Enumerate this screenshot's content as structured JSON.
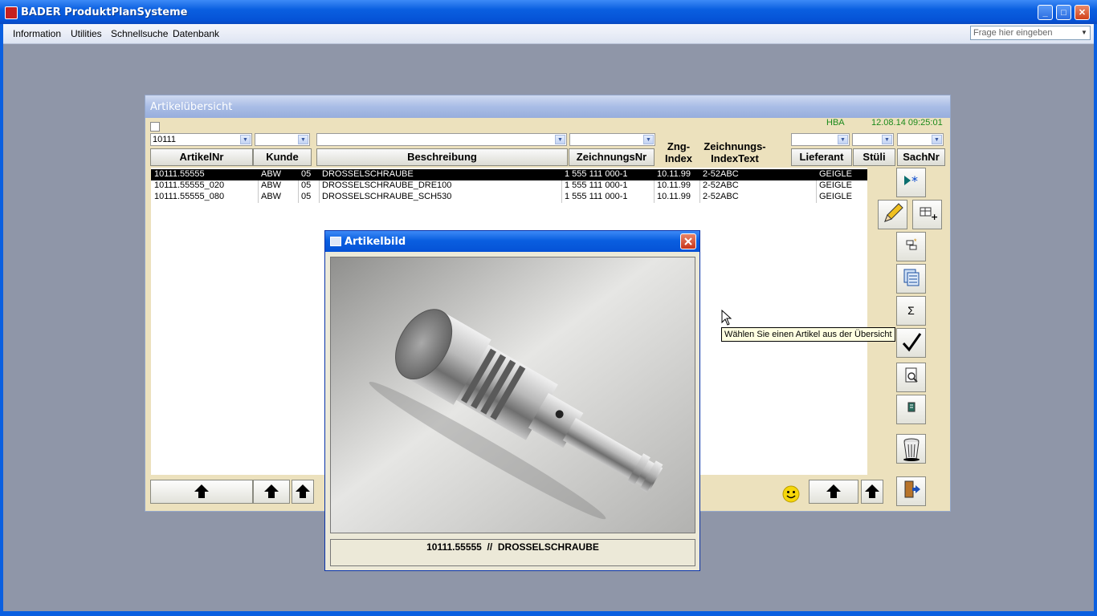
{
  "app": {
    "title": "BADER ProduktPlanSysteme"
  },
  "menu": {
    "items": [
      "Information",
      "Utilities",
      "Schnellsuche",
      "Datenbank"
    ],
    "ask_placeholder": "Frage hier eingeben"
  },
  "overview": {
    "title": "Artikelübersicht",
    "user": "HBA",
    "datetime": "12.08.14 09:25:01",
    "filter_artikel": "10111",
    "headers": {
      "artikelnr": "ArtikelNr",
      "kunde": "Kunde",
      "beschreibung": "Beschreibung",
      "zeichnungsnr": "ZeichnungsNr",
      "zng_index": "Zng-\nIndex",
      "zeichnungs_index_text": "Zeichnungs-\nIndexText",
      "lieferant": "Lieferant",
      "stueli": "Stüli",
      "sachnr": "SachNr"
    },
    "rows": [
      {
        "artikelnr": "10111.55555",
        "kunde": "ABW",
        "nr": "05",
        "beschreibung": "DROSSELSCHRAUBE",
        "zeichnungsnr": "1 555 111 000-1",
        "index": "10.11.99",
        "indextext": "2-52ABC",
        "lieferant": "GEIGLE"
      },
      {
        "artikelnr": "10111.55555_020",
        "kunde": "ABW",
        "nr": "05",
        "beschreibung": "DROSSELSCHRAUBE_DRE100",
        "zeichnungsnr": "1 555 111 000-1",
        "index": "10.11.99",
        "indextext": "2-52ABC",
        "lieferant": "GEIGLE"
      },
      {
        "artikelnr": "10111.55555_080",
        "kunde": "ABW",
        "nr": "05",
        "beschreibung": "DROSSELSCHRAUBE_SCH530",
        "zeichnungsnr": "1 555 111 000-1",
        "index": "10.11.99",
        "indextext": "2-52ABC",
        "lieferant": "GEIGLE"
      }
    ],
    "selected_row": 0
  },
  "dialog": {
    "title": "Artikelbild",
    "caption": "10111.55555  //  DROSSELSCHRAUBE"
  },
  "tooltip": "Wählen Sie einen Artikel aus der Übersicht"
}
